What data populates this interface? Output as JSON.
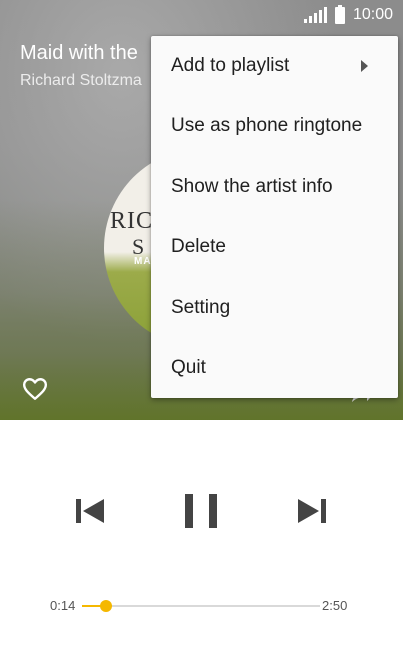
{
  "status_bar": {
    "time": "10:00",
    "signal_icon": "signal-icon",
    "battery_icon": "battery-icon"
  },
  "now_playing": {
    "title": "Maid with the",
    "artist": "Richard Stoltzma",
    "album_art_text": [
      "RIC",
      "S",
      "MA"
    ],
    "favorite_icon": "heart-outline-icon",
    "share_icon": "share-icon"
  },
  "menu": {
    "items": [
      {
        "label": "Add to playlist",
        "has_submenu": true
      },
      {
        "label": "Use as phone ringtone"
      },
      {
        "label": "Show the artist info"
      },
      {
        "label": "Delete"
      },
      {
        "label": "Setting"
      },
      {
        "label": "Quit"
      }
    ]
  },
  "controls": {
    "previous_icon": "skip-previous-icon",
    "pause_icon": "pause-icon",
    "next_icon": "skip-next-icon"
  },
  "progress": {
    "elapsed": "0:14",
    "duration": "2:50",
    "fraction": 0.1,
    "accent_color": "#f5b800"
  }
}
